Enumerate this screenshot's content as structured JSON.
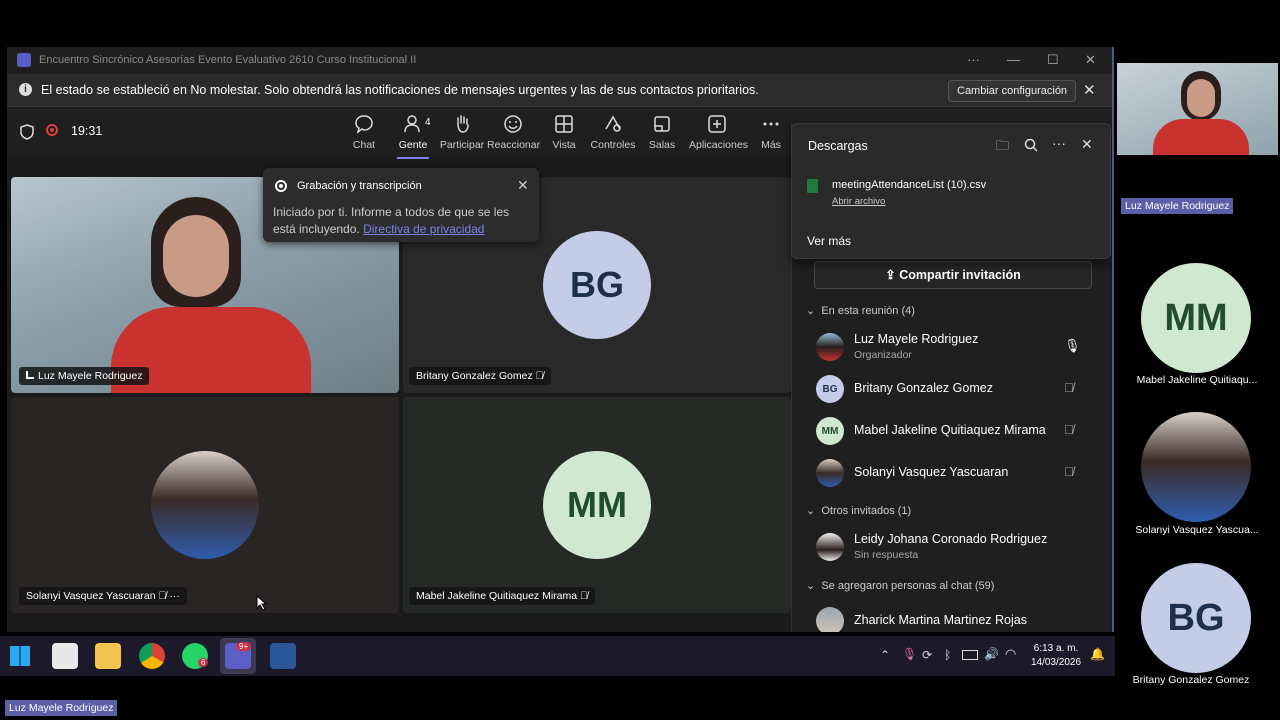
{
  "window": {
    "title": "Encuentro Sincrónico Asesorías Evento Evaluativo 2610 Curso Institucional II"
  },
  "notice": {
    "message": "El estado se estableció en No molestar. Solo obtendrá las notificaciones de mensajes urgentes y las de sus contactos prioritarios.",
    "button": "Cambiar configuración"
  },
  "toolbar": {
    "time": "19:31",
    "people_count": "4",
    "items": [
      "Chat",
      "Gente",
      "Participar",
      "Reaccionar",
      "Vista",
      "Controles",
      "Salas",
      "Aplicaciones",
      "Más"
    ]
  },
  "recording": {
    "title": "Grabación y transcripción",
    "body": "Iniciado por ti. Informe a todos de que se les está incluyendo.",
    "link": "Directiva de privacidad"
  },
  "tiles": [
    {
      "name": "Luz Mayele Rodriguez"
    },
    {
      "name": "Britany Gonzalez Gomez",
      "initials": "BG"
    },
    {
      "name": "Solanyi Vasquez Yascuaran"
    },
    {
      "name": "Mabel Jakeline Quitiaquez Mirama",
      "initials": "MM"
    }
  ],
  "downloads": {
    "title": "Descargas",
    "file": "meetingAttendanceList (10).csv",
    "open": "Abrir archivo",
    "more": "Ver más"
  },
  "panel": {
    "share": "Compartir invitación",
    "in_meeting": "En esta reunión (4)",
    "others": "Otros invitados (1)",
    "added": "Se agregaron personas al chat (59)",
    "people": [
      {
        "name": "Luz Mayele Rodriguez",
        "sub": "Organizador"
      },
      {
        "name": "Britany Gonzalez Gomez",
        "initials": "BG"
      },
      {
        "name": "Mabel Jakeline Quitiaquez Mirama",
        "initials": "MM"
      },
      {
        "name": "Solanyi Vasquez Yascuaran"
      }
    ],
    "invited": {
      "name": "Leidy Johana Coronado Rodriguez",
      "sub": "Sin respuesta"
    },
    "chat_person": {
      "name": "Zharick Martina Martinez Rojas"
    }
  },
  "taskbar": {
    "clock_time": "6:13 a. m.",
    "clock_date": "14/03/2026",
    "whatsapp_badge": "6",
    "teams_badge": "9+"
  },
  "strip": {
    "top_label": "Luz Mayele Rodriguez",
    "p1": {
      "initials": "MM",
      "name": "Mabel Jakeline Quitiaqu..."
    },
    "p2": {
      "name": "Solanyi Vasquez Yascua..."
    },
    "p3": {
      "initials": "BG",
      "name": "Britany Gonzalez Gomez"
    }
  },
  "bottom_label": "Luz Mayele Rodriguez",
  "colors": {
    "bg_avatar": "#c3cde8",
    "bg_initials": "#1e2e4d",
    "mm_avatar": "#cfe8cf",
    "mm_initials": "#1f4d2e",
    "accent": "#7b83eb",
    "record": "#e03e3e"
  }
}
